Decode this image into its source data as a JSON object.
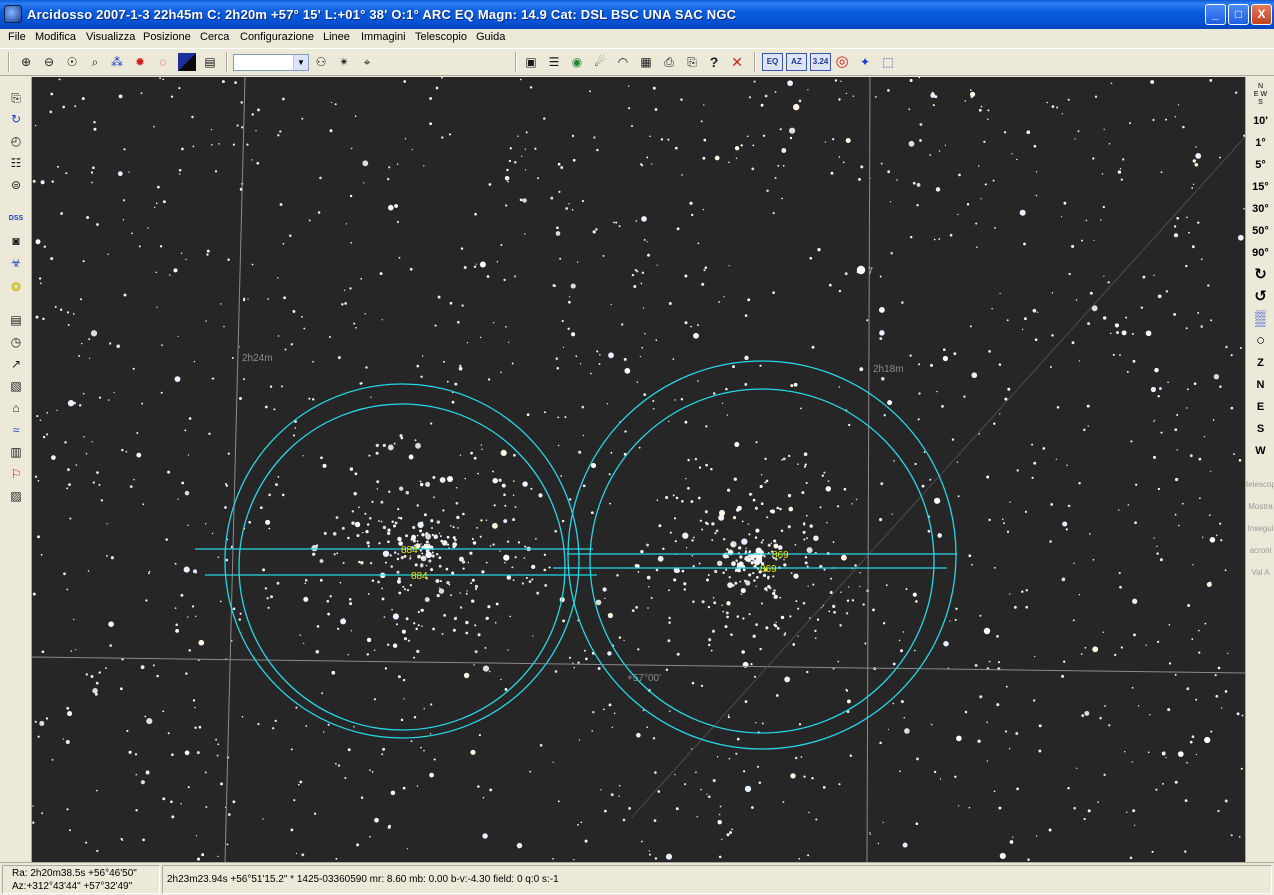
{
  "window": {
    "title": "Arcidosso 2007-1-3  22h45m C:  2h20m +57° 15' L:+01° 38' O:1°  ARC EQ Magn: 14.9 Cat: DSL BSC UNA SAC NGC",
    "minimize_label": "_",
    "maximize_label": "□",
    "close_label": "X"
  },
  "menu": {
    "items": [
      "File",
      "Modifica",
      "Visualizza",
      "Posizione",
      "Cerca",
      "Configurazione",
      "Linee",
      "Immagini",
      "Telescopio",
      "Guida"
    ]
  },
  "toolbar": {
    "combo_value": "",
    "combo_arrow": "▼",
    "icons": {
      "zoom_in": "⊕",
      "zoom_out": "⊖",
      "zoom_fit": "☉",
      "find": "⌕",
      "stars": "⁂",
      "sun": "✹",
      "planets": "◌",
      "contrast": "◩",
      "doc": "▤",
      "binoculars": "⚇",
      "find_star": "✴",
      "find_obj": "⌖",
      "save": "▣",
      "notes": "☰",
      "globe": "◉",
      "satellite": "☄",
      "dome": "◠",
      "calendar": "▦",
      "print": "⎙",
      "print_preview": "⎘",
      "help": "?",
      "quit": "✕",
      "eq_label": "EQ",
      "az_label": "AZ",
      "coords_label": "3.24",
      "target": "◎",
      "constellation": "✦",
      "frame": "⬚"
    }
  },
  "left_toolbar": {
    "icons": [
      "⎘",
      "↻",
      "◴",
      "☷",
      "⊜",
      "DSS",
      "◙",
      "☣",
      "❂",
      "▤",
      "◷",
      "↗",
      "▧",
      "⌂",
      "≈",
      "▥",
      "⚐",
      "▨"
    ]
  },
  "right_toolbar": {
    "compass_n": "N",
    "compass_s": "S",
    "compass_e": "E",
    "compass_w": "W",
    "fov_buttons": [
      "10'",
      "1°",
      "5°",
      "15°",
      "30°",
      "50°",
      "90°"
    ],
    "rotate_cw": "↻",
    "rotate_ccw": "↺",
    "pattern": "▒",
    "circle": "○",
    "dir_buttons": [
      "Z",
      "N",
      "E",
      "S",
      "W"
    ],
    "faded_buttons": [
      "telescop",
      "Mostra",
      "Insegui",
      "acroni",
      "Val A"
    ]
  },
  "sky": {
    "grid_labels": {
      "ra_left": "2h24m",
      "ra_right": "2h18m",
      "dec": "+57°00'"
    },
    "star_label": "7",
    "object_labels": [
      "884",
      "884",
      "869",
      "869"
    ],
    "overlay_color": "#27d6e6",
    "label_color": "#e4e418",
    "grid_color": "#9a9a9a"
  },
  "status": {
    "ra_line": "Ra:  2h20m38.5s +56°46'50\"",
    "az_line": "Az:+312°43'44\" +57°32'49\"",
    "object_info": "2h23m23.94s +56°51'15.2\"   * 1425-03360590 mr: 8.60 mb: 0.00 b-v:-4.30 field:  0 q:0 s:-1"
  }
}
